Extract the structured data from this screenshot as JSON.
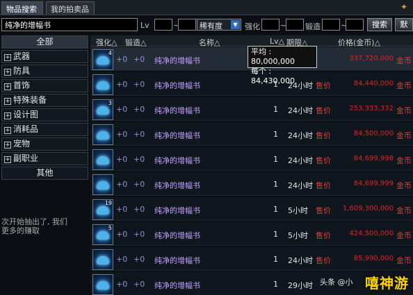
{
  "tabs": [
    {
      "label": "物品搜索",
      "active": true
    },
    {
      "label": "我的拍卖品",
      "active": false
    }
  ],
  "search": {
    "name_value": "纯净的增幅书",
    "lv_label": "Lv",
    "tilde1": "~",
    "rarity_value": "稀有度",
    "enhance_label": "强化",
    "tilde2": "~",
    "forge_label": "锻造",
    "tilde3": "~",
    "search_button": "搜索",
    "default_button": "默"
  },
  "categories": [
    {
      "label": "全部",
      "plus": false,
      "active": true
    },
    {
      "label": "武器",
      "plus": true
    },
    {
      "label": "防具",
      "plus": true
    },
    {
      "label": "首饰",
      "plus": true
    },
    {
      "label": "特殊装备",
      "plus": true
    },
    {
      "label": "设计图",
      "plus": true
    },
    {
      "label": "消耗品",
      "plus": true
    },
    {
      "label": "宠物",
      "plus": true
    },
    {
      "label": "副职业",
      "plus": true
    },
    {
      "label": "其他",
      "plus": false
    }
  ],
  "side_note": "次开始抽出了, 我们\n更多的赚取",
  "columns": {
    "enhance": "强化△",
    "forge": "锻造△",
    "name": "名称△",
    "lv": "Lv△",
    "period": "期限△",
    "price": "价格(金币)△"
  },
  "tooltip": {
    "avg_label": "平均 :",
    "avg_value": "80,000,000",
    "each_label": "每个 :",
    "each_value": "84,430,000"
  },
  "rows": [
    {
      "count": "4",
      "enhance": "+0",
      "forge": "+0",
      "name": "纯净的增幅书",
      "lv": "",
      "time": "",
      "sale": "",
      "price": "337,720,000",
      "unit": "金币"
    },
    {
      "count": "",
      "enhance": "+0",
      "forge": "+0",
      "name": "纯净的增幅书",
      "lv": "1",
      "time": "24小时",
      "sale": "售价",
      "price": "84,440,000",
      "unit": "金币"
    },
    {
      "count": "3",
      "enhance": "+0",
      "forge": "+0",
      "name": "纯净的增幅书",
      "lv": "1",
      "time": "24小时",
      "sale": "售价",
      "price": "253,333,332",
      "unit": "金币"
    },
    {
      "count": "",
      "enhance": "+0",
      "forge": "+0",
      "name": "纯净的增幅书",
      "lv": "1",
      "time": "24小时",
      "sale": "售价",
      "price": "84,500,000",
      "unit": "金币"
    },
    {
      "count": "",
      "enhance": "+0",
      "forge": "+0",
      "name": "纯净的增幅书",
      "lv": "1",
      "time": "24小时",
      "sale": "售价",
      "price": "84,699,998",
      "unit": "金币"
    },
    {
      "count": "",
      "enhance": "+0",
      "forge": "+0",
      "name": "纯净的增幅书",
      "lv": "1",
      "time": "24小时",
      "sale": "售价",
      "price": "84,699,999",
      "unit": "金币"
    },
    {
      "count": "19",
      "enhance": "+0",
      "forge": "+0",
      "name": "纯净的增幅书",
      "lv": "1",
      "time": "5小时",
      "sale": "售价",
      "price": "1,609,300,000",
      "unit": "金币"
    },
    {
      "count": "5",
      "enhance": "+0",
      "forge": "+0",
      "name": "纯净的增幅书",
      "lv": "1",
      "time": "5小时",
      "sale": "售价",
      "price": "424,500,000",
      "unit": "金币"
    },
    {
      "count": "",
      "enhance": "+0",
      "forge": "+0",
      "name": "纯净的增幅书",
      "lv": "1",
      "time": "24小时",
      "sale": "售价",
      "price": "85,990,000",
      "unit": "金币"
    },
    {
      "count": "",
      "enhance": "+0",
      "forge": "+0",
      "name": "纯净的增幅书",
      "lv": "1",
      "time": "29小时",
      "sale": "",
      "price": "",
      "unit": ""
    }
  ],
  "watermark": "头条 @小",
  "brand": "嘻神游"
}
